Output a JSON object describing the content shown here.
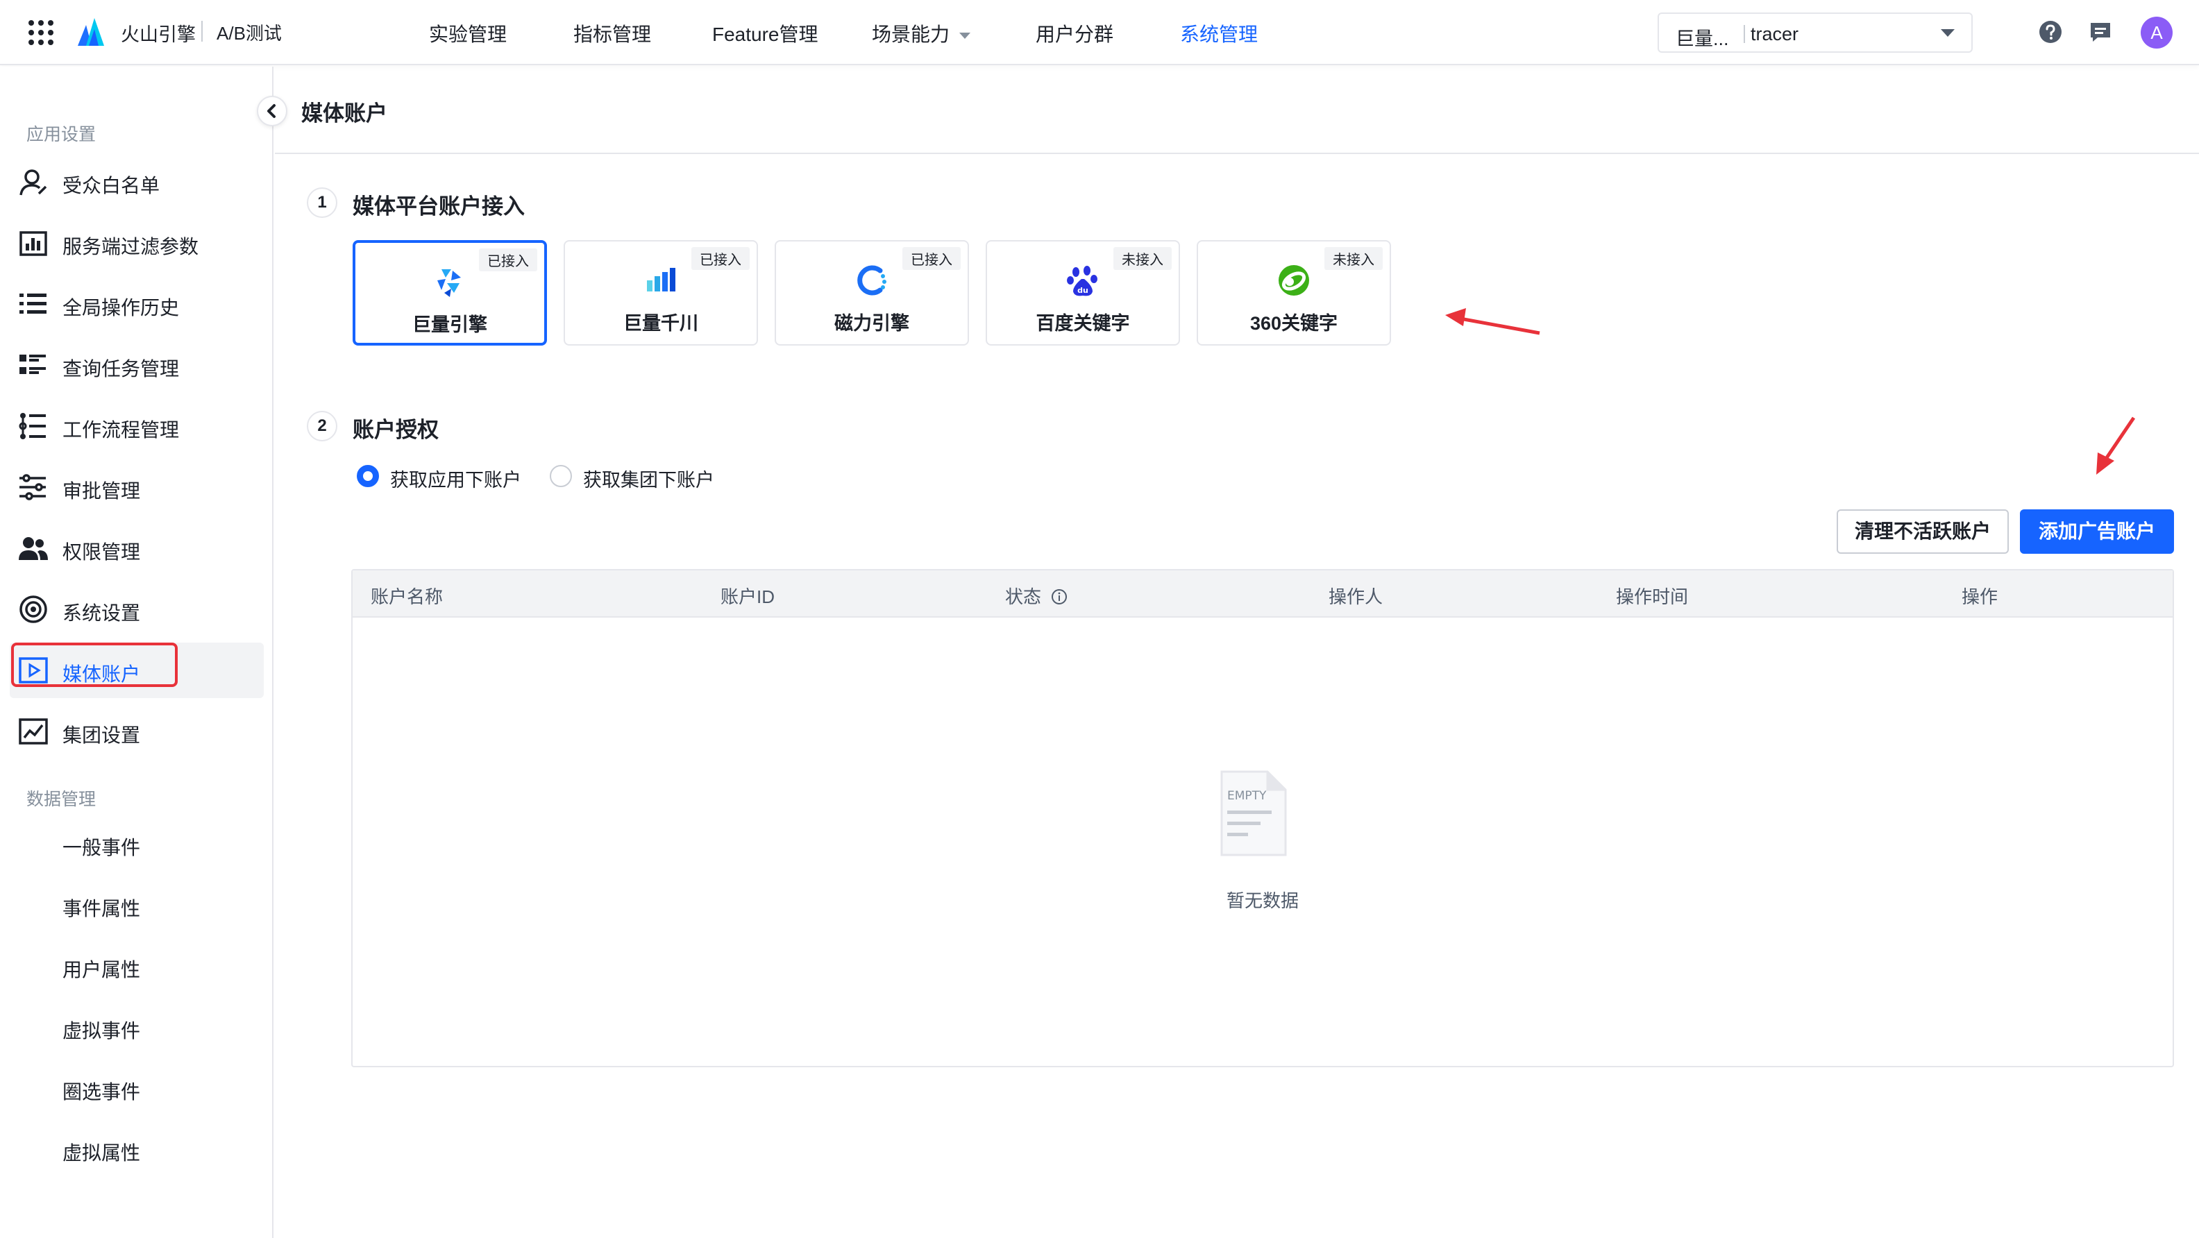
{
  "topbar": {
    "brand": "火山引擎",
    "product": "A/B测试",
    "nav": [
      {
        "label": "实验管理"
      },
      {
        "label": "指标管理"
      },
      {
        "label": "Feature管理"
      },
      {
        "label": "场景能力"
      },
      {
        "label": "用户分群"
      },
      {
        "label": "系统管理"
      }
    ],
    "active_nav": "系统管理",
    "org_name": "巨量...",
    "app_name": "tracer",
    "avatar_letter": "A"
  },
  "sidebar": {
    "group1": "应用设置",
    "items": [
      {
        "label": "受众白名单",
        "icon": "user-icon"
      },
      {
        "label": "服务端过滤参数",
        "icon": "filter-params-icon"
      },
      {
        "label": "全局操作历史",
        "icon": "list-icon"
      },
      {
        "label": "查询任务管理",
        "icon": "task-list-icon"
      },
      {
        "label": "工作流程管理",
        "icon": "workflow-icon"
      },
      {
        "label": "审批管理",
        "icon": "sliders-icon"
      },
      {
        "label": "权限管理",
        "icon": "users-icon"
      },
      {
        "label": "系统设置",
        "icon": "target-icon"
      },
      {
        "label": "媒体账户",
        "icon": "play-square-icon"
      },
      {
        "label": "集团设置",
        "icon": "chart-line-icon"
      }
    ],
    "active_item": "媒体账户",
    "group2": "数据管理",
    "sub_items": [
      "一般事件",
      "事件属性",
      "用户属性",
      "虚拟事件",
      "圈选事件",
      "虚拟属性"
    ]
  },
  "page": {
    "title": "媒体账户",
    "step1": {
      "num": "1",
      "title": "媒体平台账户接入"
    },
    "media_cards": [
      {
        "name": "巨量引擎",
        "status": "已接入",
        "logo": "ocean-engine-logo"
      },
      {
        "name": "巨量千川",
        "status": "已接入",
        "logo": "qianchuan-logo"
      },
      {
        "name": "磁力引擎",
        "status": "已接入",
        "logo": "cili-logo"
      },
      {
        "name": "百度关键字",
        "status": "未接入",
        "logo": "baidu-logo"
      },
      {
        "name": "360关键字",
        "status": "未接入",
        "logo": "360-logo"
      }
    ],
    "step2": {
      "num": "2",
      "title": "账户授权"
    },
    "radio_options": [
      {
        "label": "获取应用下账户",
        "checked": true
      },
      {
        "label": "获取集团下账户",
        "checked": false
      }
    ],
    "buttons": {
      "clean": "清理不活跃账户",
      "add": "添加广告账户"
    },
    "table": {
      "columns": [
        "账户名称",
        "账户ID",
        "状态",
        "操作人",
        "操作时间",
        "操作"
      ],
      "empty_text": "暂无数据",
      "empty_icon_text": "EMPTY"
    }
  },
  "colors": {
    "primary": "#1664ff",
    "highlight": "#e8323a",
    "avatar": "#8b5cf6"
  }
}
